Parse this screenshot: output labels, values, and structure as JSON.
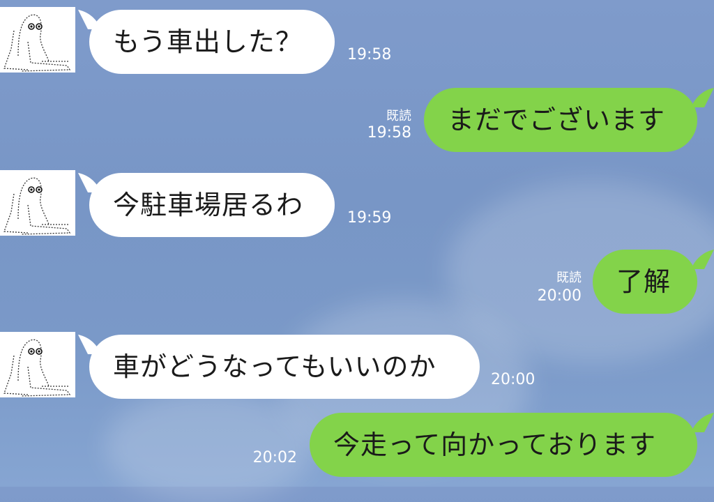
{
  "messages": [
    {
      "side": "in",
      "text": "もう車出した？",
      "time": "19:58"
    },
    {
      "side": "out",
      "text": "まだでございます",
      "time": "19:58",
      "read": "既読"
    },
    {
      "side": "in",
      "text": "今駐車場居るわ",
      "time": "19:59"
    },
    {
      "side": "out",
      "text": "了解",
      "time": "20:00",
      "read": "既読"
    },
    {
      "side": "in",
      "text": "車がどうなってもいいのか",
      "time": "20:00"
    },
    {
      "side": "out",
      "text": "今走って向かっております",
      "time": "20:02"
    }
  ],
  "colors": {
    "incoming_bubble": "#ffffff",
    "outgoing_bubble": "#83d34a",
    "background": "#7f9bcb"
  },
  "icons": {
    "avatar": "ascii-art-character-avatar"
  }
}
